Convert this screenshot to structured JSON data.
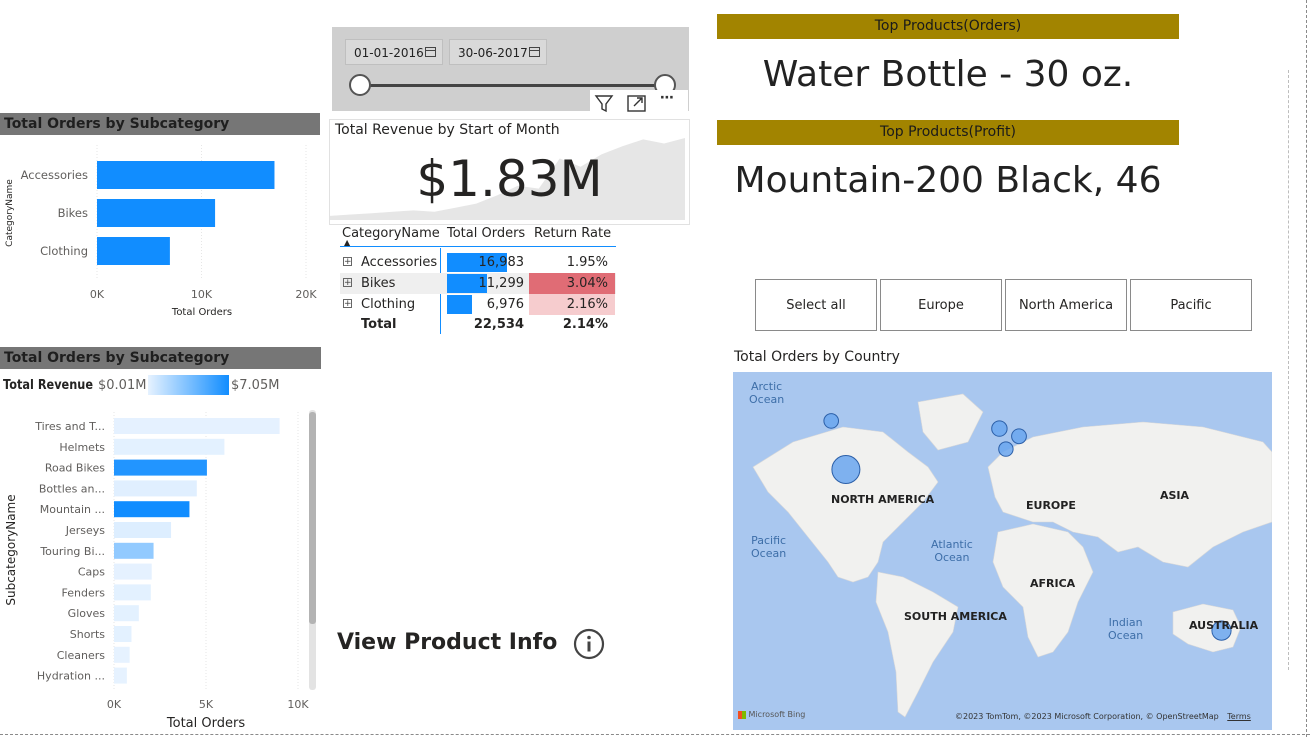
{
  "top_products": {
    "orders_header": "Top Products(Orders)",
    "orders_value": "Water Bottle - 30 oz.",
    "profit_header": "Top Products(Profit)",
    "profit_value": "Mountain-200 Black, 46"
  },
  "date_slicer": {
    "start_date": "01-01-2016",
    "end_date": "30-06-2017"
  },
  "revenue_card": {
    "title": "Total Revenue by Start of Month",
    "value": "$1.83M"
  },
  "matrix": {
    "headers": [
      "CategoryName",
      "Total Orders",
      "Return Rate"
    ],
    "rows": [
      {
        "name": "Accessories",
        "orders": "16,983",
        "rate": "1.95%",
        "orders_fraction": 0.754,
        "rate_level": 0.0
      },
      {
        "name": "Bikes",
        "orders": "11,299",
        "rate": "3.04%",
        "orders_fraction": 0.501,
        "rate_level": 1.0
      },
      {
        "name": "Clothing",
        "orders": "6,976",
        "rate": "2.16%",
        "orders_fraction": 0.31,
        "rate_level": 0.2
      }
    ],
    "total": {
      "name": "Total",
      "orders": "22,534",
      "rate": "2.14%"
    }
  },
  "region_slicer": {
    "options": [
      "Select all",
      "Europe",
      "North America",
      "Pacific"
    ]
  },
  "map": {
    "title": "Total Orders by Country",
    "continents": [
      "NORTH AMERICA",
      "EUROPE",
      "ASIA",
      "AFRICA",
      "SOUTH AMERICA",
      "AUSTRALIA"
    ],
    "oceans": [
      {
        "line1": "Arctic",
        "line2": "Ocean"
      },
      {
        "line1": "Pacific",
        "line2": "Ocean"
      },
      {
        "line1": "Atlantic",
        "line2": "Ocean"
      },
      {
        "line1": "Indian",
        "line2": "Ocean"
      }
    ],
    "brand": "Microsoft Bing",
    "attribution": "©2023 TomTom, ©2023 Microsoft Corporation, © OpenStreetMap",
    "terms": "Terms"
  },
  "view_product_info": {
    "label": "View Product Info",
    "info_icon": "info-circle-icon"
  },
  "icons": {
    "calendar": "calendar-icon",
    "filter": "filter-icon",
    "focus": "focus-mode-icon",
    "more": "more-options-icon"
  },
  "colors": {
    "bar_blue": "#118dff",
    "gold": "#a28400",
    "header_gray": "#767676",
    "return_high": "#e06c75",
    "return_low": "#fce4e4",
    "map_water": "#a9c7ef",
    "map_land": "#f1f1ef",
    "bubble": "#6aa6ef"
  },
  "chart_data": [
    {
      "type": "bar",
      "orientation": "horizontal",
      "title": "Total Orders by Subcategory",
      "xlabel": "Total Orders",
      "ylabel": "CategoryName",
      "categories": [
        "Accessories",
        "Bikes",
        "Clothing"
      ],
      "values": [
        16983,
        11299,
        6976
      ],
      "xlim": [
        0,
        20000
      ],
      "xticks": [
        "0K",
        "10K",
        "20K"
      ],
      "xtick_values": [
        0,
        10000,
        20000
      ]
    },
    {
      "type": "bar",
      "orientation": "horizontal",
      "title": "Total Orders by Subcategory",
      "xlabel": "Total Orders",
      "ylabel": "SubcategoryName",
      "legend": {
        "label": "Total Revenue",
        "min_label": "$0.01M",
        "max_label": "$7.05M",
        "min": 0.01,
        "max": 7.05
      },
      "categories": [
        "Tires and T...",
        "Helmets",
        "Road Bikes",
        "Bottles an...",
        "Mountain ...",
        "Jerseys",
        "Touring Bi...",
        "Caps",
        "Fenders",
        "Gloves",
        "Shorts",
        "Cleaners",
        "Hydration ..."
      ],
      "values": [
        9000,
        6000,
        5050,
        4500,
        4100,
        3100,
        2150,
        2050,
        2000,
        1350,
        950,
        850,
        700
      ],
      "color_values": [
        0.05,
        0.1,
        6.5,
        0.2,
        7.05,
        0.3,
        2.8,
        0.05,
        0.1,
        0.1,
        0.1,
        0.02,
        0.01
      ],
      "xlim": [
        0,
        10000
      ],
      "xticks": [
        "0K",
        "5K",
        "10K"
      ],
      "xtick_values": [
        0,
        5000,
        10000
      ]
    },
    {
      "type": "area",
      "title": "Total Revenue by Start of Month",
      "values": [
        0.3,
        0.4,
        0.5,
        0.6,
        0.7,
        0.6,
        0.9,
        1.2,
        1.8,
        2.5,
        2.3,
        4.5,
        3.9,
        4.8,
        5.4,
        5.9,
        5.6,
        6.0
      ]
    },
    {
      "type": "scatter",
      "title": "Total Orders by Country",
      "points": [
        {
          "lon": -96,
          "lat": 38,
          "size": 11000
        },
        {
          "lon": -105,
          "lat": 57,
          "size": 1200
        },
        {
          "lon": -2,
          "lat": 54,
          "size": 1500
        },
        {
          "lon": 10,
          "lat": 51,
          "size": 1300
        },
        {
          "lon": 2,
          "lat": 46,
          "size": 1100
        },
        {
          "lon": 134,
          "lat": -25,
          "size": 3500
        }
      ]
    }
  ]
}
